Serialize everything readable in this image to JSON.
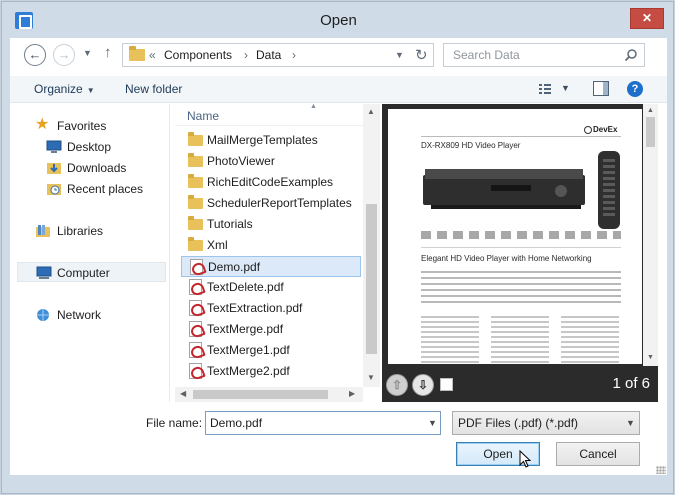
{
  "window": {
    "title": "Open",
    "close_glyph": "✕"
  },
  "address": {
    "chevrons": "«",
    "segments": [
      "Components",
      "Data"
    ],
    "separator": "›"
  },
  "search": {
    "placeholder": "Search Data"
  },
  "toolbar": {
    "organize_label": "Organize",
    "new_folder_label": "New folder",
    "help_glyph": "?"
  },
  "nav": {
    "favorites_label": "Favorites",
    "desktop_label": "Desktop",
    "downloads_label": "Downloads",
    "recent_label": "Recent places",
    "libraries_label": "Libraries",
    "computer_label": "Computer",
    "network_label": "Network"
  },
  "files": {
    "column_name": "Name",
    "items": [
      {
        "name": "MailMergeTemplates",
        "type": "folder"
      },
      {
        "name": "PhotoViewer",
        "type": "folder"
      },
      {
        "name": "RichEditCodeExamples",
        "type": "folder"
      },
      {
        "name": "SchedulerReportTemplates",
        "type": "folder"
      },
      {
        "name": "Tutorials",
        "type": "folder"
      },
      {
        "name": "Xml",
        "type": "folder"
      },
      {
        "name": "Demo.pdf",
        "type": "pdf",
        "selected": true
      },
      {
        "name": "TextDelete.pdf",
        "type": "pdf"
      },
      {
        "name": "TextExtraction.pdf",
        "type": "pdf"
      },
      {
        "name": "TextMerge.pdf",
        "type": "pdf"
      },
      {
        "name": "TextMerge1.pdf",
        "type": "pdf"
      },
      {
        "name": "TextMerge2.pdf",
        "type": "pdf"
      }
    ]
  },
  "preview": {
    "page_indicator": "1 of 6",
    "doc_logo": "DevEx",
    "doc_model": "DX-RX809  HD Video Player",
    "doc_heading": "Elegant HD Video Player with Home Networking"
  },
  "bottom": {
    "file_name_label": "File name:",
    "file_name_value": "Demo.pdf",
    "file_type_value": "PDF Files (.pdf) (*.pdf)",
    "open_label": "Open",
    "cancel_label": "Cancel"
  },
  "colors": {
    "accent": "#1e6fc9",
    "close": "#c54c43",
    "selection": "#dbe9f8",
    "frame": "#cfdbe7"
  }
}
